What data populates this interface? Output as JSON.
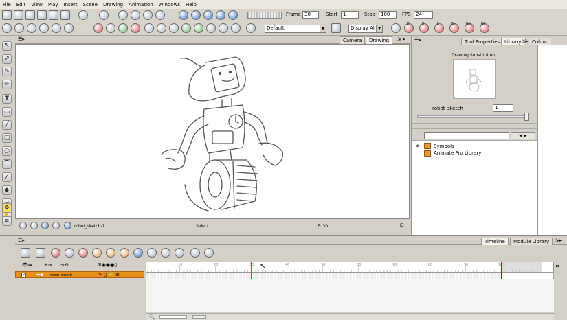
{
  "menu": [
    "File",
    "Edit",
    "View",
    "Play",
    "Insert",
    "Scene",
    "Drawing",
    "Animation",
    "Windows",
    "Help"
  ],
  "playback": {
    "frame_label": "Frame",
    "frame_value": "30",
    "start_label": "Start",
    "start_value": "1",
    "stop_label": "Stop",
    "stop_value": "100",
    "fps_label": "FPS",
    "fps_value": "24"
  },
  "toolbar2": {
    "palette_select": "Default",
    "display_select": "Display All"
  },
  "keys": [
    "K",
    "E",
    "L",
    "Kn",
    "Ne",
    "Nl"
  ],
  "view_tabs": {
    "camera": "Camera",
    "drawing": "Drawing"
  },
  "status": {
    "drawing_name": "robot_sketch-1",
    "mode": "Select",
    "frame": "Fr 30"
  },
  "right_tabs": {
    "tool_properties": "Tool Properties",
    "library": "Library",
    "colour": "Colour"
  },
  "substitution": {
    "title": "Drawing Substitution",
    "element_name": "robot_sketch",
    "value": "1"
  },
  "library_tree": [
    "Symbols",
    "Animate Pro Library"
  ],
  "bottom_tabs": {
    "timeline": "Timeline",
    "module_library": "Module Library"
  },
  "timeline": {
    "layer_name": "robot_sketch",
    "ruler_labels": [
      "10",
      "20",
      "30",
      "40",
      "50",
      "60",
      "70",
      "80",
      "90",
      "100"
    ],
    "current_frame": 30,
    "stop_frame": 100
  }
}
